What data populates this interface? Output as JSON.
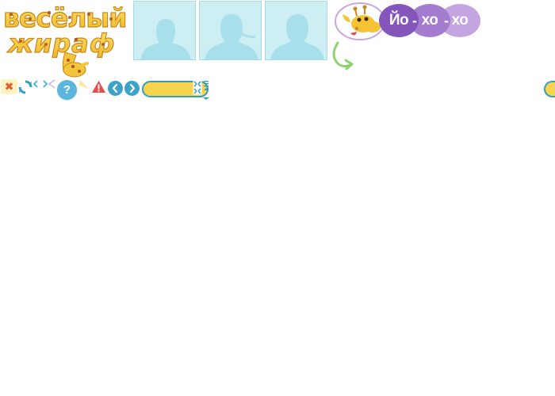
{
  "logo": {
    "line1": "весёлый",
    "line2": "жираф",
    "icon": "giraffe-logo"
  },
  "avatars": [
    {
      "icon": "question-silhouette-icon"
    },
    {
      "icon": "female-silhouette-icon"
    },
    {
      "icon": "male-silhouette-icon"
    }
  ],
  "mascot": {
    "icon": "giraffe-mascot-icon"
  },
  "yoho": {
    "word1": "Йо",
    "word2": "хо",
    "word3": "хо",
    "dash": "-"
  },
  "toolbar": {
    "close_icon": "close-icon",
    "close_glyph": "✖",
    "refresh_icon": "refresh-icon",
    "code_icon": "code-icon",
    "share_icon": "share-icon",
    "help_glyph": "?",
    "alert_icon": "alert-icon",
    "prev_icon": "chevron-left-icon",
    "next_icon": "chevron-right-icon",
    "search_value": "",
    "search_placeholder": "",
    "fullscreen_icon": "fullscreen-icon",
    "menu_icon": "menu-icon"
  },
  "colors": {
    "accent_blue": "#2f9fc4",
    "yellow": "#f7d44c",
    "purple_dark": "#8456bb",
    "purple_mid": "#a37ccf",
    "purple_light": "#c4a4e1",
    "alert_red": "#e64b4b",
    "avatar_bg": "#cdeff4"
  }
}
